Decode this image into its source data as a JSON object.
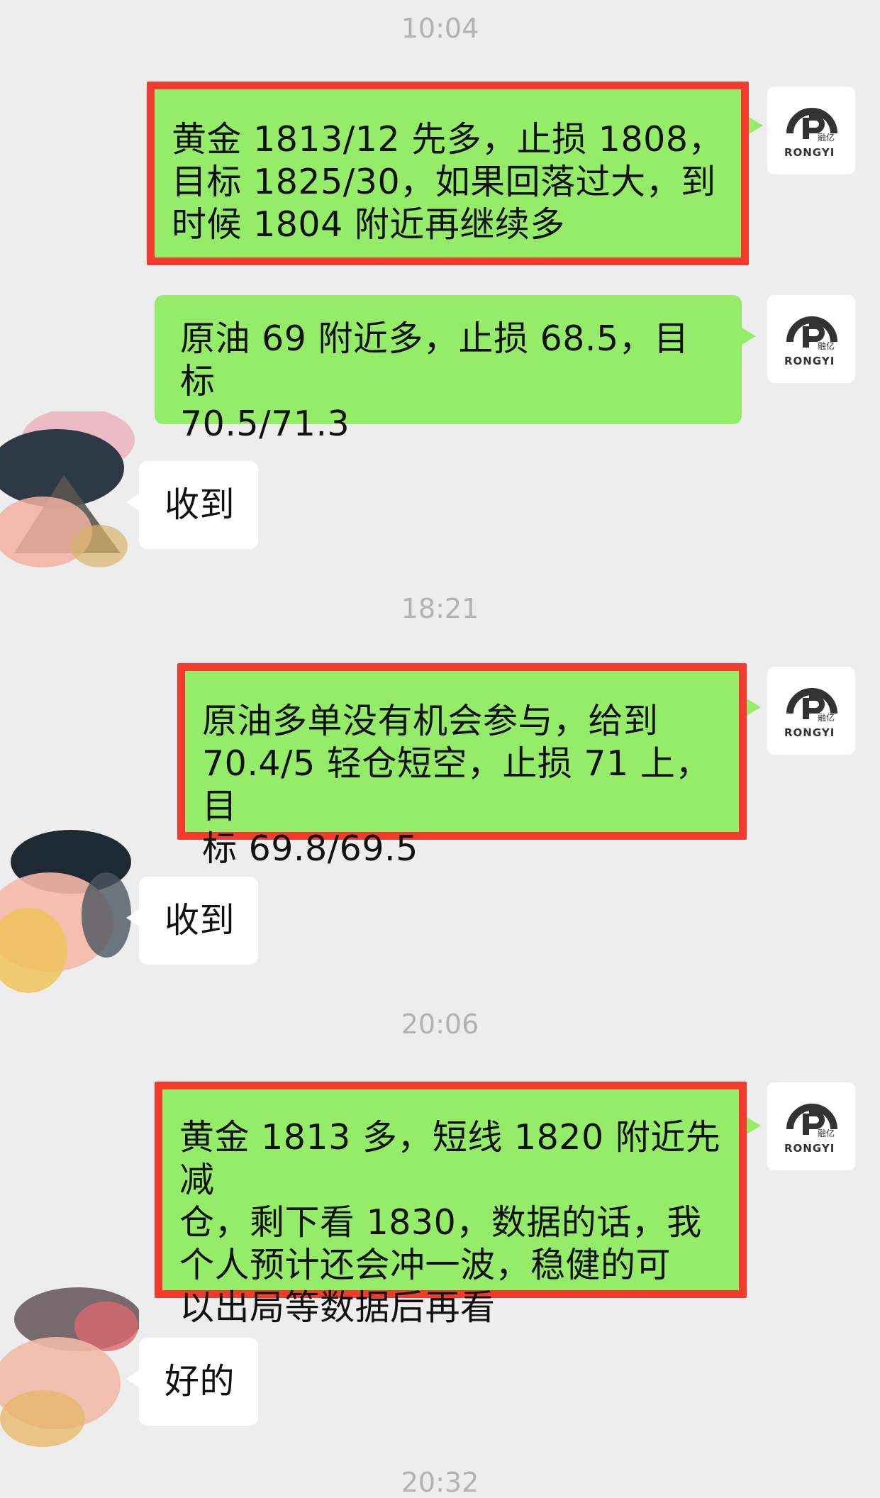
{
  "timestamps": [
    "10:04",
    "18:21",
    "20:06",
    "20:32"
  ],
  "brand": {
    "avatar_text": "RONGYI",
    "avatar_cn": "融亿"
  },
  "messages": [
    {
      "from": "self",
      "lines": [
        "黄金 1813/12 先多，止损 1808，",
        "目标 1825/30，如果回落过大，到",
        "时候 1804 附近再继续多"
      ]
    },
    {
      "from": "self",
      "lines": [
        "原油 69 附近多，止损 68.5，目标",
        "70.5/71.3"
      ]
    },
    {
      "from": "other",
      "lines": [
        "收到"
      ]
    },
    {
      "from": "self",
      "lines": [
        "原油多单没有机会参与，给到",
        "70.4/5 轻仓短空，止损 71 上，目",
        "标 69.8/69.5"
      ]
    },
    {
      "from": "other",
      "lines": [
        "收到"
      ]
    },
    {
      "from": "self",
      "lines": [
        "黄金 1813 多，短线 1820 附近先减",
        "仓，剩下看 1830，数据的话，我",
        "个人预计还会冲一波，稳健的可",
        "以出局等数据后再看"
      ]
    },
    {
      "from": "other",
      "lines": [
        "好的"
      ]
    }
  ]
}
